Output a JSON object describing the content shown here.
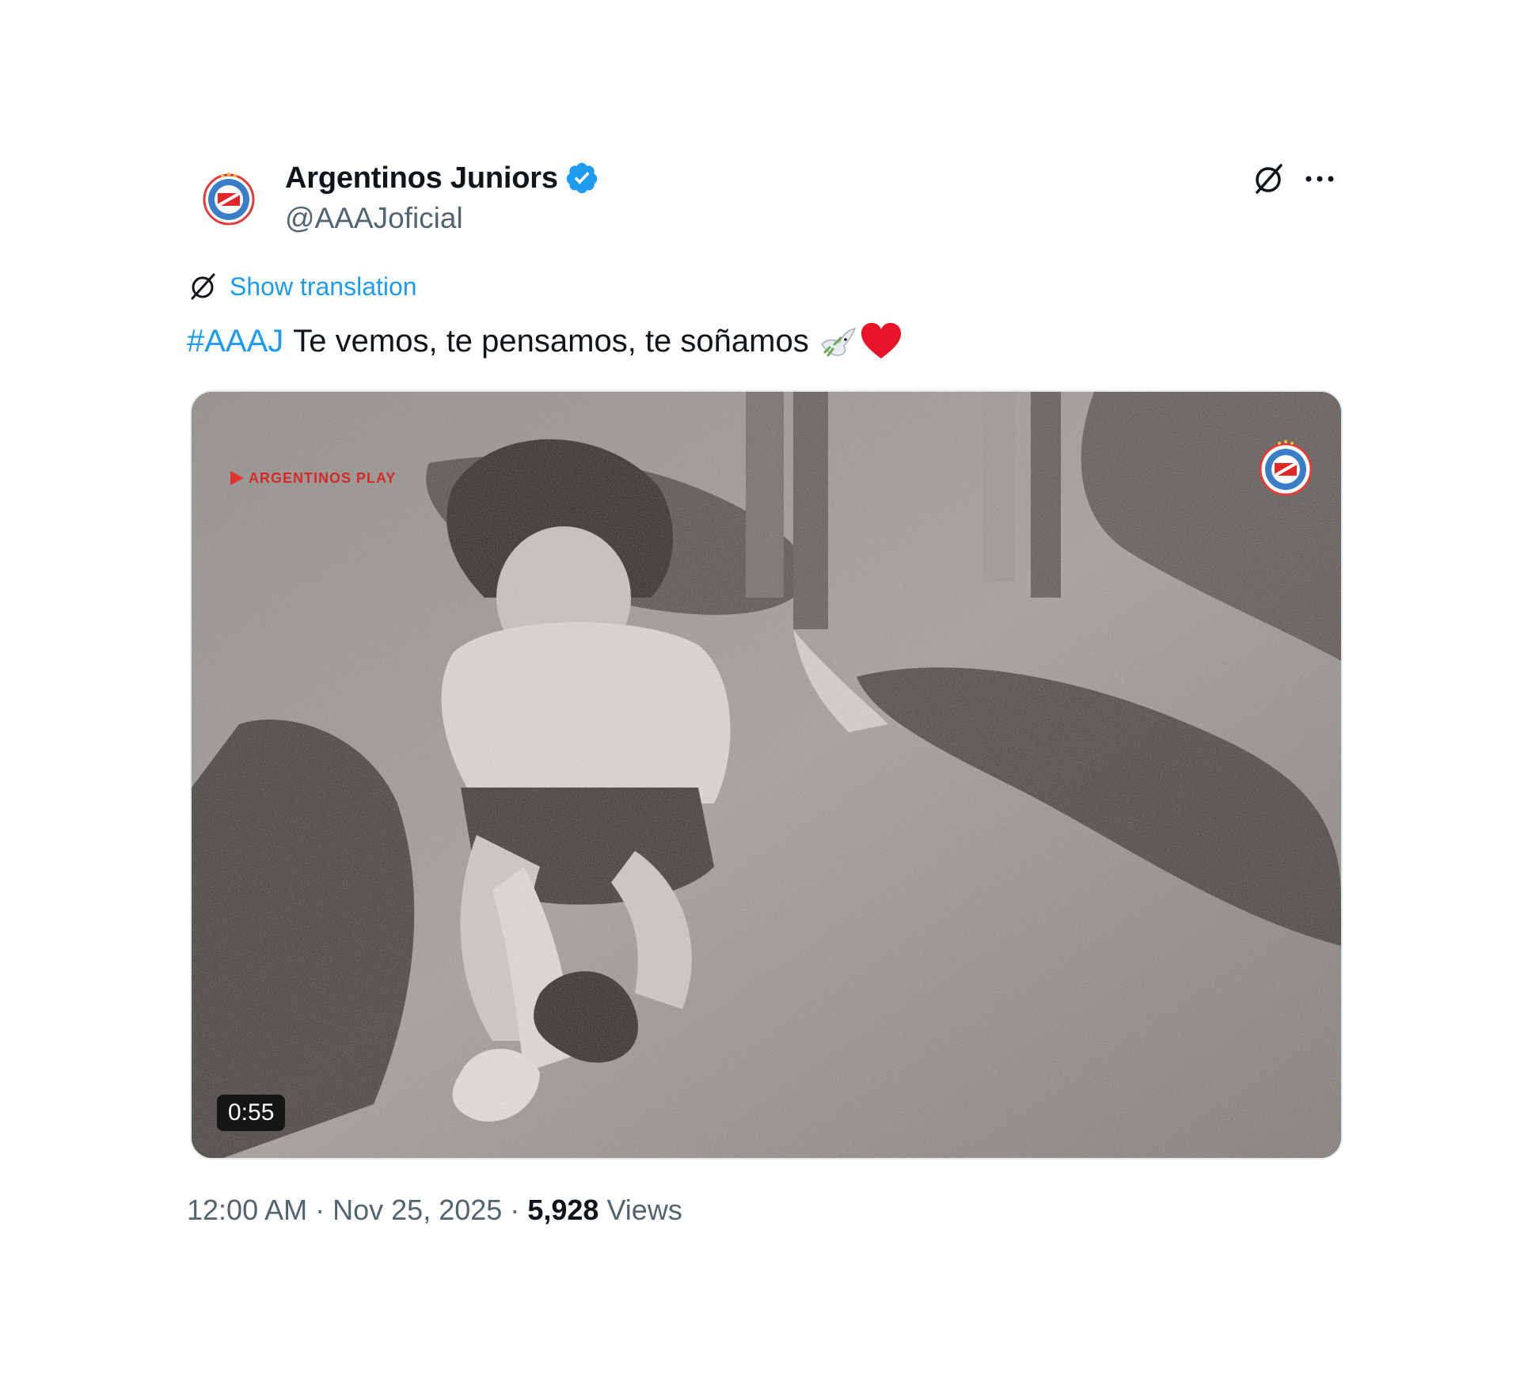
{
  "account": {
    "display_name": "Argentinos Juniors",
    "handle": "@AAAJoficial",
    "verified": true,
    "avatar": "argentinos-juniors-crest"
  },
  "actions": {
    "grok_icon": "grok-icon",
    "more_icon": "more-icon"
  },
  "translation": {
    "label": "Show translation"
  },
  "post": {
    "hashtag": "#AAAJ",
    "text": "Te vemos, te pensamos, te soñamos",
    "emojis": [
      "dove",
      "red-heart"
    ]
  },
  "media": {
    "type": "video",
    "duration": "0:55",
    "watermark_text": "ARGENTINOS PLAY",
    "logo": "argentinos-juniors-crest"
  },
  "meta": {
    "time": "12:00 AM",
    "separator": "·",
    "date": "Nov 25, 2025",
    "views_count": "5,928",
    "views_label": "Views"
  },
  "colors": {
    "accent": "#1d9bf0",
    "text": "#0f1419",
    "secondary": "#536471",
    "heart": "#f91880"
  }
}
